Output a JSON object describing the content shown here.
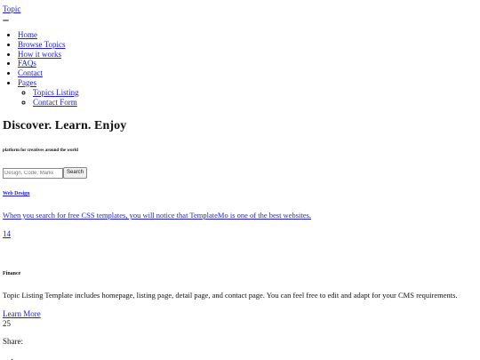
{
  "navbar": {
    "brand": "Topic",
    "items": [
      {
        "label": "Home"
      },
      {
        "label": "Browse Topics"
      },
      {
        "label": "How it works"
      },
      {
        "label": "FAQs"
      },
      {
        "label": "Contact"
      },
      {
        "label": "Pages",
        "children": [
          {
            "label": "Topics Listing"
          },
          {
            "label": "Contact Form"
          }
        ]
      }
    ]
  },
  "hero": {
    "title": "Discover. Learn. Enjoy",
    "subtitle": "platform for creatives around the world",
    "search": {
      "placeholder": "Design, Code, Marketing, Finance ...",
      "button_label": "Search"
    }
  },
  "cards": [
    {
      "category": "Web Design",
      "description": "When you search for free CSS templates, you will notice that TemplateMo is one of the best websites.",
      "count": "14"
    },
    {
      "category": "Finance",
      "description": "Topic Listing Template includes homepage, listing page, detail page, and contact page. You can feel free to edit and adapt for your CMS requirements.",
      "link_label": "Learn More",
      "count": "25"
    }
  ],
  "share": {
    "label": "Share:",
    "icon": "share-icon"
  }
}
